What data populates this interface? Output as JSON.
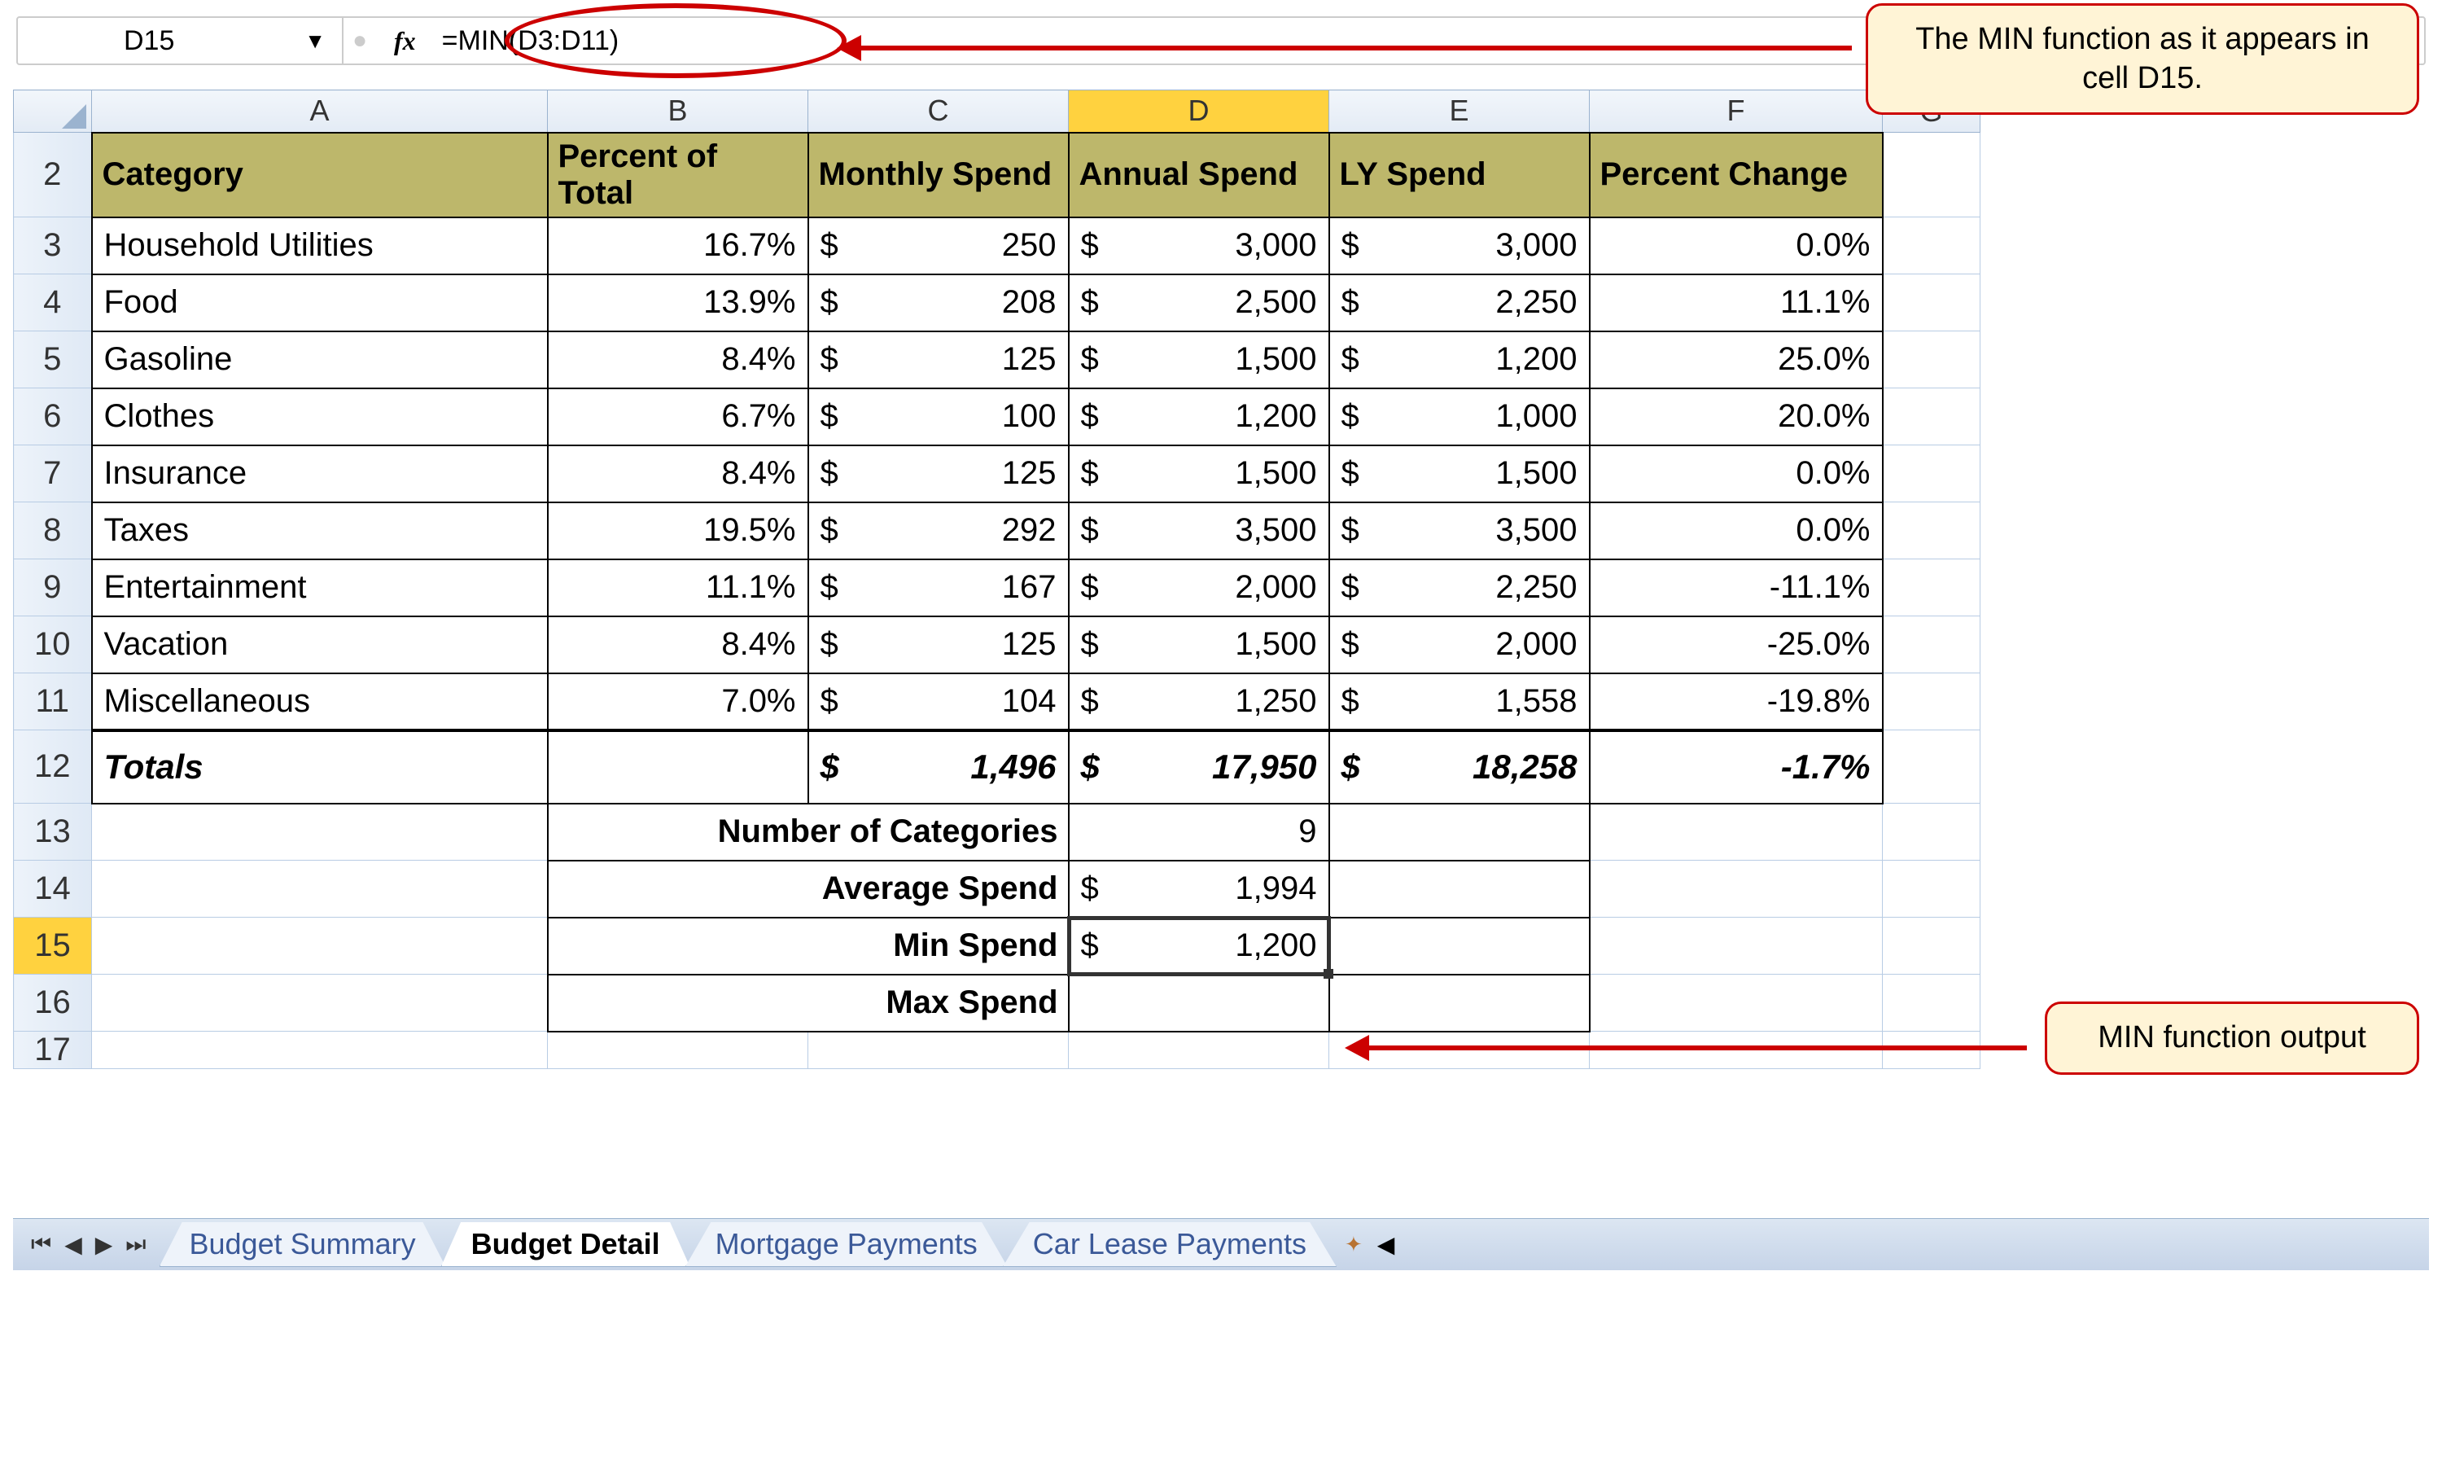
{
  "formula_bar": {
    "cell_ref": "D15",
    "fx_label": "fx",
    "formula": "=MIN(D3:D11)"
  },
  "columns": [
    "A",
    "B",
    "C",
    "D",
    "E",
    "F",
    "G"
  ],
  "active_col": "D",
  "active_row": "15",
  "headers": {
    "category": "Category",
    "percent_total": "Percent of Total",
    "monthly_spend": "Monthly Spend",
    "annual_spend": "Annual Spend",
    "ly_spend": "LY Spend",
    "percent_change": "Percent Change"
  },
  "rows": [
    {
      "n": "3",
      "category": "Household Utilities",
      "pct": "16.7%",
      "monthly": "250",
      "annual": "3,000",
      "ly": "3,000",
      "chg": "0.0%"
    },
    {
      "n": "4",
      "category": "Food",
      "pct": "13.9%",
      "monthly": "208",
      "annual": "2,500",
      "ly": "2,250",
      "chg": "11.1%"
    },
    {
      "n": "5",
      "category": "Gasoline",
      "pct": "8.4%",
      "monthly": "125",
      "annual": "1,500",
      "ly": "1,200",
      "chg": "25.0%"
    },
    {
      "n": "6",
      "category": "Clothes",
      "pct": "6.7%",
      "monthly": "100",
      "annual": "1,200",
      "ly": "1,000",
      "chg": "20.0%"
    },
    {
      "n": "7",
      "category": "Insurance",
      "pct": "8.4%",
      "monthly": "125",
      "annual": "1,500",
      "ly": "1,500",
      "chg": "0.0%"
    },
    {
      "n": "8",
      "category": "Taxes",
      "pct": "19.5%",
      "monthly": "292",
      "annual": "3,500",
      "ly": "3,500",
      "chg": "0.0%"
    },
    {
      "n": "9",
      "category": "Entertainment",
      "pct": "11.1%",
      "monthly": "167",
      "annual": "2,000",
      "ly": "2,250",
      "chg": "-11.1%"
    },
    {
      "n": "10",
      "category": "Vacation",
      "pct": "8.4%",
      "monthly": "125",
      "annual": "1,500",
      "ly": "2,000",
      "chg": "-25.0%"
    },
    {
      "n": "11",
      "category": "Miscellaneous",
      "pct": "7.0%",
      "monthly": "104",
      "annual": "1,250",
      "ly": "1,558",
      "chg": "-19.8%"
    }
  ],
  "totals": {
    "label": "Totals",
    "monthly": "1,496",
    "annual": "17,950",
    "ly": "18,258",
    "chg": "-1.7%"
  },
  "stats": {
    "num_cat_label": "Number of Categories",
    "num_cat_val": "9",
    "avg_label": "Average Spend",
    "avg_val": "1,994",
    "min_label": "Min Spend",
    "min_val": "1,200",
    "max_label": "Max Spend",
    "max_val": ""
  },
  "sheet_tabs": {
    "t1": "Budget Summary",
    "t2": "Budget Detail",
    "t3": "Mortgage Payments",
    "t4": "Car Lease Payments"
  },
  "callouts": {
    "top": "The MIN function as it appears in cell D15.",
    "bottom": "MIN function output"
  },
  "glyphs": {
    "dollar": "$",
    "nav_first": "⏮",
    "nav_prev": "◀",
    "nav_next": "▶",
    "nav_last": "⏭",
    "dropdown": "▼"
  }
}
